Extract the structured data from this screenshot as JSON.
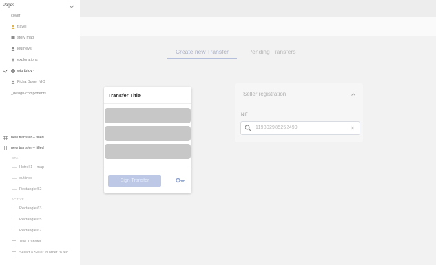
{
  "layers_panel": {
    "title": "Pages",
    "pages": [
      {
        "label": "cover",
        "icon": "none"
      },
      {
        "label": "travel",
        "icon": "person-icon"
      },
      {
        "label": "story map",
        "icon": "map-icon"
      },
      {
        "label": "journeys",
        "icon": "person-icon"
      },
      {
        "label": "explorations",
        "icon": "pin-icon"
      },
      {
        "label": "wip tbfoy -",
        "icon": "compass-icon",
        "active": true
      },
      {
        "label": "Ficha Buyer NIO",
        "icon": "person-icon"
      },
      {
        "label": "_design-components",
        "icon": "none"
      }
    ],
    "frames": [
      {
        "label": "new transfer – filled"
      },
      {
        "label": "new transfer – filled"
      }
    ],
    "layers": [
      {
        "type": "section",
        "label": "CTA"
      },
      {
        "type": "item",
        "label": "Hotrel 1 – map"
      },
      {
        "type": "item",
        "label": "outlines"
      },
      {
        "type": "item",
        "label": "Rectangle 52"
      },
      {
        "type": "section",
        "label": "ACTIVE"
      },
      {
        "type": "item",
        "label": "Rectangle 63"
      },
      {
        "type": "item",
        "label": "Rectangle 65"
      },
      {
        "type": "item",
        "label": "Rectangle 67"
      },
      {
        "type": "item",
        "label": "Title Transfer"
      },
      {
        "type": "item",
        "label": "Select a Seller in order to fed..."
      }
    ]
  },
  "tabs": [
    {
      "label": "Create new Transfer",
      "active": true
    },
    {
      "label": "Pending Transfers",
      "active": false
    }
  ],
  "transfer_card": {
    "title": "Transfer Title",
    "sign_button": "Sign Transfer",
    "key_icon": "key-icon"
  },
  "seller_registration": {
    "title": "Seller registration",
    "nif_label": "NIF",
    "nif_value": "119802985252499"
  },
  "colors": {
    "accent": "#b3bfdc",
    "button": "#bcc8e6",
    "skeleton": "#c7c7c7",
    "background": "#f2f2f2"
  }
}
